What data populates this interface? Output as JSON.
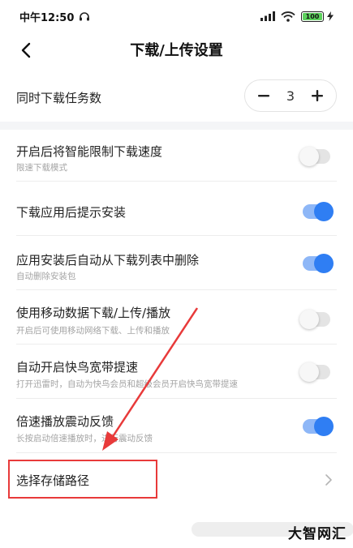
{
  "status_bar": {
    "time": "中午12:50",
    "battery": "100",
    "headphone_icon": "headphone-icon",
    "signal_icon": "cellular-signal-icon",
    "wifi_icon": "wifi-icon",
    "charging_icon": "lightning-icon"
  },
  "header": {
    "title": "下载/上传设置",
    "back_icon": "chevron-left-icon"
  },
  "concurrent": {
    "label": "同时下载任务数",
    "value": "3",
    "minus_icon": "minus-icon",
    "plus_icon": "plus-icon"
  },
  "settings": [
    {
      "title": "开启后将智能限制下载速度",
      "subtitle": "限速下载模式",
      "enabled": false
    },
    {
      "title": "下载应用后提示安装",
      "subtitle": "",
      "enabled": true
    },
    {
      "title": "应用安装后自动从下载列表中删除",
      "subtitle": "自动删除安装包",
      "enabled": true
    },
    {
      "title": "使用移动数据下载/上传/播放",
      "subtitle": "开启后可使用移动网络下载、上传和播放",
      "enabled": false
    },
    {
      "title": "自动开启快鸟宽带提速",
      "subtitle": "打开迅雷时，自动为快鸟会员和超级会员开启快鸟宽带提速",
      "enabled": false
    },
    {
      "title": "倍速播放震动反馈",
      "subtitle": "长按启动倍速播放时，进行震动反馈",
      "enabled": true
    }
  ],
  "storage": {
    "label": "选择存储路径",
    "chevron_icon": "chevron-right-icon"
  },
  "colors": {
    "accent": "#2f7ef3",
    "toggle_track_on": "#8eb7f7",
    "toggle_track_off": "#e4e4e4",
    "annotation": "#e83a3a"
  },
  "watermark": "大智网汇"
}
